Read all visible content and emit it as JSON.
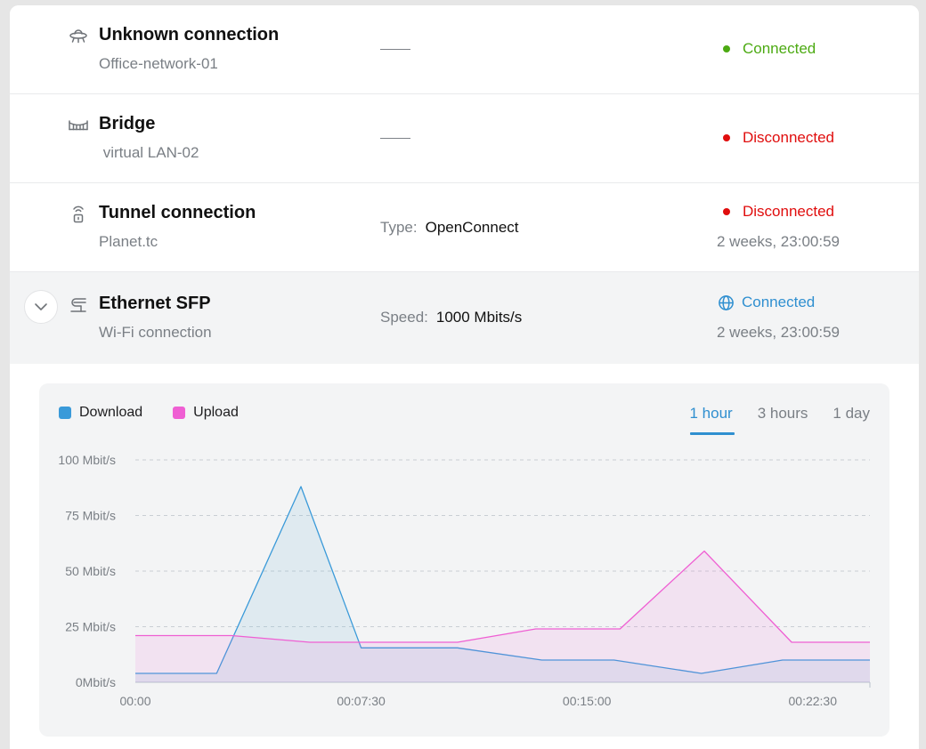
{
  "connections": [
    {
      "title": "Unknown connection",
      "subtitle": "Office-network-01",
      "icon": "ufo-icon",
      "detail": null,
      "status": "Connected",
      "status_kind": "ok",
      "uptime": null
    },
    {
      "title": "Bridge",
      "subtitle": " virtual LAN-02",
      "icon": "bridge-icon",
      "detail": null,
      "status": "Disconnected",
      "status_kind": "bad",
      "uptime": null
    },
    {
      "title": "Tunnel connection",
      "subtitle": "Planet.tc",
      "icon": "tunnel-lock-icon",
      "detail_key": "Type:",
      "detail_value": "OpenConnect",
      "status": "Disconnected",
      "status_kind": "bad",
      "uptime": "2 weeks, 23:00:59"
    },
    {
      "title": "Ethernet SFP",
      "subtitle": "Wi-Fi connection",
      "icon": "ethernet-sfp-icon",
      "detail_key": "Speed:",
      "detail_value": "1000 Mbits/s",
      "status": "Connected",
      "status_kind": "net",
      "uptime": "2 weeks, 23:00:59"
    }
  ],
  "colors": {
    "connected": "#4caa12",
    "disconnected": "#e00d0d",
    "accent": "#2f8fd0",
    "download": "#3a9ad9",
    "upload": "#ef5fd3"
  },
  "chart_data": {
    "type": "area",
    "legend": [
      "Download",
      "Upload"
    ],
    "range_tabs": [
      "1 hour",
      "3 hours",
      "1 day"
    ],
    "active_range": "1 hour",
    "y_ticks": [
      "0Mbit/s",
      "25 Mbit/s",
      "50 Mbit/s",
      "75 Mbit/s",
      "100 Mbit/s"
    ],
    "x_ticks": [
      "00:00",
      "00:07:30",
      "00:15:00",
      "00:22:30"
    ],
    "x_tick_minutes": [
      0,
      7.5,
      15,
      22.5
    ],
    "ylim": [
      0,
      100
    ],
    "xlim_minutes": [
      0,
      24.4
    ],
    "grid": true,
    "legend_position": "top-left",
    "series": [
      {
        "name": "Download",
        "x": [
          0,
          2.7,
          5.5,
          7.5,
          10.7,
          13.5,
          15.9,
          18.8,
          21.5,
          24.4
        ],
        "values": [
          4,
          4,
          88,
          15.5,
          15.5,
          10,
          10,
          4,
          10,
          10
        ]
      },
      {
        "name": "Upload",
        "x": [
          0,
          3.2,
          5.8,
          8.2,
          10.7,
          13.3,
          16.1,
          18.9,
          21.8,
          24.4
        ],
        "values": [
          21,
          21,
          18,
          18,
          18,
          24,
          24,
          59,
          18,
          18
        ]
      }
    ]
  }
}
